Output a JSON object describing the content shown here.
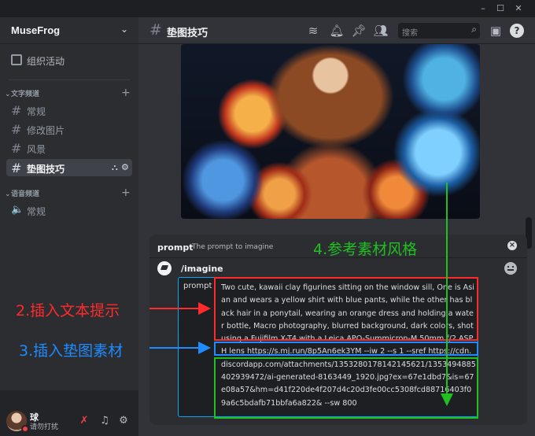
{
  "window": {
    "minimize": "–",
    "maximize": "☐",
    "close": "✕"
  },
  "server": {
    "name": "MuseFrog"
  },
  "sidebar": {
    "event_label": "组织活动",
    "text_category": "文字频道",
    "voice_category": "语音频道",
    "text_channels": [
      {
        "name": "常规"
      },
      {
        "name": "修改图片"
      },
      {
        "name": "风景"
      },
      {
        "name": "垫图技巧",
        "active": true
      }
    ],
    "voice_channels": [
      {
        "name": "常规"
      }
    ]
  },
  "user": {
    "name": "球",
    "status": "请勿打扰"
  },
  "header": {
    "channel": "垫图技巧",
    "search_placeholder": "搜索"
  },
  "command": {
    "option": "prompt",
    "description": "The prompt to imagine",
    "command": "/imagine",
    "field_label": "prompt",
    "text": "Two cute, kawaii clay figurines sitting on the window sill, One is Asian and wears a yellow shirt with blue pants, while the other has black hair in a ponytail, wearing an orange dress and holding a water bottle, Macro photography, blurred background, dark colors, shot using a Fujifilm X-T4 with a Leica APO-Summicron-M 50mm f/2 ASPH lens https://s.mj.run/8p5An6ek3YM --iw 2 --s 1 --sref https://cdn.discordapp.com/attachments/1353280178142145621/1353494885402939472/ai-generated-8163449_1920.jpg?ex=67e1dbd7&is=67e08a57&hm=d41f220de4f207d4c20d3fe00cc5308fcd88716403f09a6c5bdafb71bbfa6a822& --sw 800"
  },
  "annotations": {
    "text_prompt": "2.插入文本提示",
    "image_prompt": "3.插入垫图素材",
    "style_ref": "4.参考素材风格"
  },
  "colors": {
    "red": "#ff2a2a",
    "blue": "#1e8bff",
    "green": "#21c021"
  }
}
